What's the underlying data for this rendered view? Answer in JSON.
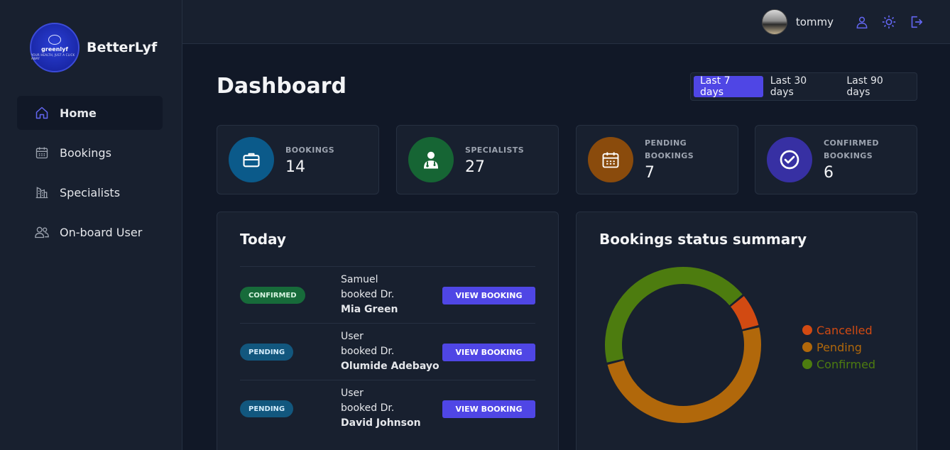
{
  "brand": {
    "name": "BetterLyf",
    "logo_text": "greenlyf",
    "logo_tagline": "YOUR HEALTH, JUST A CLICK AWAY"
  },
  "sidebar": {
    "items": [
      {
        "label": "Home",
        "icon": "home-icon",
        "active": true
      },
      {
        "label": "Bookings",
        "icon": "calendar-icon",
        "active": false
      },
      {
        "label": "Specialists",
        "icon": "building-icon",
        "active": false
      },
      {
        "label": "On-board User",
        "icon": "users-icon",
        "active": false
      }
    ]
  },
  "header": {
    "username": "tommy",
    "icons": [
      "user-icon",
      "sun-icon",
      "logout-icon"
    ]
  },
  "page": {
    "title": "Dashboard",
    "ranges": [
      {
        "label": "Last 7 days",
        "active": true
      },
      {
        "label": "Last 30 days",
        "active": false
      },
      {
        "label": "Last 90 days",
        "active": false
      }
    ]
  },
  "stats": [
    {
      "label": "BOOKINGS",
      "value": "14",
      "color": "#0b5a8a",
      "icon": "briefcase-icon"
    },
    {
      "label": "SPECIALISTS",
      "value": "27",
      "color": "#166534",
      "icon": "doctor-icon"
    },
    {
      "label": "PENDING BOOKINGS",
      "value": "7",
      "color": "#8a4b0c",
      "icon": "calendar-icon"
    },
    {
      "label": "CONFIRMED BOOKINGS",
      "value": "6",
      "color": "#3730a3",
      "icon": "check-circle-icon"
    }
  ],
  "today": {
    "title": "Today",
    "rows": [
      {
        "status": "CONFIRMED",
        "user": "Samuel",
        "middle": "booked Dr.",
        "doctor": "Mia Green",
        "action": "VIEW BOOKING"
      },
      {
        "status": "PENDING",
        "user": "User",
        "middle": "booked Dr.",
        "doctor": "Olumide Adebayo",
        "action": "VIEW BOOKING"
      },
      {
        "status": "PENDING",
        "user": "User",
        "middle": "booked Dr.",
        "doctor": "David Johnson",
        "action": "VIEW BOOKING"
      }
    ]
  },
  "summary": {
    "title": "Bookings status summary"
  },
  "chart_data": {
    "type": "pie",
    "title": "Bookings status summary",
    "categories": [
      "Cancelled",
      "Pending",
      "Confirmed"
    ],
    "values": [
      1,
      7,
      6
    ],
    "colors": [
      "#d24a12",
      "#b1680b",
      "#4d7c0f"
    ],
    "legend": "right"
  }
}
